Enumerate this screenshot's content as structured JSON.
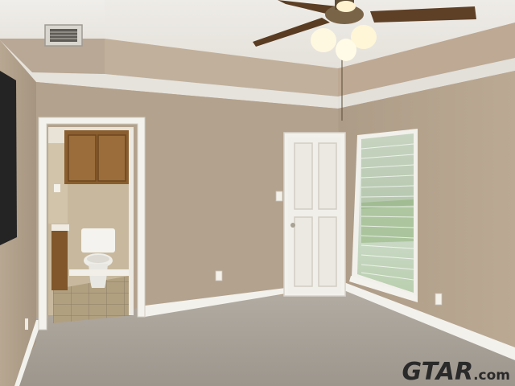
{
  "photo": {
    "subject": "",
    "colors": {
      "wall": "#b5a48f",
      "wall_shadow": "#a79681",
      "ceiling": "#e9e7e2",
      "tray_ledge": "#c4b39e",
      "carpet": "#aaa49c",
      "trim": "#f4f2ed",
      "door": "#f1efe9",
      "cabinet": "#8a5e2e",
      "tile": "#b3a384",
      "window_glass": "#dfe8e2",
      "tv": "#262626"
    },
    "icons": [
      "ceiling-fan-icon",
      "toilet-icon",
      "vent-icon",
      "door-knob-icon"
    ]
  },
  "watermark": {
    "brand": "GTAR",
    "suffix": ".com"
  }
}
